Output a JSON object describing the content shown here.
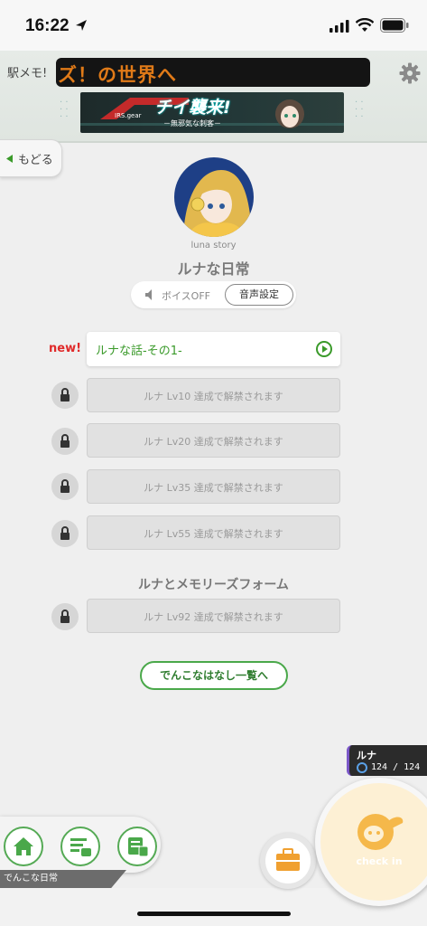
{
  "status_bar": {
    "time": "16:22"
  },
  "header": {
    "station_memo_label": "駅メモ!",
    "ticker_text": "ズ！の世界へ",
    "banner": {
      "brand": "IRS.gear",
      "headline": "チイ襲来!",
      "subline": "－無邪気な刺客－"
    }
  },
  "nav": {
    "back_label": "もどる"
  },
  "story": {
    "series_small": "luna story",
    "title": "ルナな日常",
    "voice_status": "ボイスOFF",
    "voice_settings_label": "音声設定"
  },
  "episodes": [
    {
      "badge": "new!",
      "label": "ルナな話-その1-",
      "locked": false
    },
    {
      "label": "ルナ Lv10 達成で解禁されます",
      "locked": true
    },
    {
      "label": "ルナ Lv20 達成で解禁されます",
      "locked": true
    },
    {
      "label": "ルナ Lv35 達成で解禁されます",
      "locked": true
    },
    {
      "label": "ルナ Lv55 達成で解禁されます",
      "locked": true
    }
  ],
  "section2": {
    "title": "ルナとメモリーズフォーム",
    "episodes": [
      {
        "label": "ルナ Lv92 達成で解禁されます",
        "locked": true
      }
    ]
  },
  "list_button_label": "でんこなはなし一覧へ",
  "character": {
    "name": "ルナ",
    "hp": "124 / 124"
  },
  "bottom_nav": {
    "caption": "でんこな日常"
  },
  "checkin_label": "check in",
  "colors": {
    "accent_green": "#4aa84a",
    "new_red": "#e02a2a",
    "checkin_orange": "#f5b84a"
  }
}
